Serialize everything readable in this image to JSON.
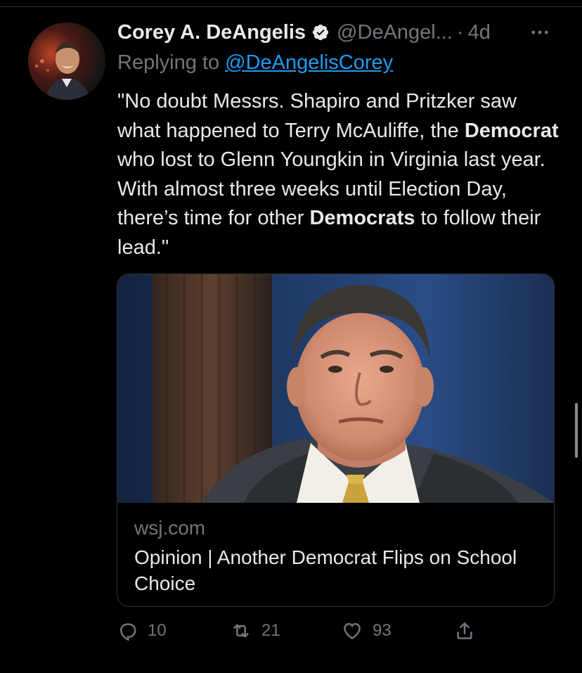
{
  "tweet": {
    "author": {
      "display_name": "Corey A. DeAngelis",
      "handle": "@DeAngel...",
      "verified": true
    },
    "separator": "·",
    "time": "4d",
    "reply": {
      "prefix": "Replying to ",
      "mention": "@DeAngelisCorey"
    },
    "text": {
      "part1": "\"No doubt Messrs. Shapiro and Pritzker saw what happened to Terry McAuliffe, the ",
      "bold1": "Democrat",
      "part2": " who lost to Glenn Youngkin in Virginia last year. With almost three weeks until Election Day, there’s time for other ",
      "bold2": "Democrats",
      "part3": " to follow their lead.\""
    },
    "card": {
      "domain": "wsj.com",
      "title": "Opinion | Another Democrat Flips on School Choice"
    },
    "actions": {
      "reply_count": "10",
      "retweet_count": "21",
      "like_count": "93"
    }
  },
  "colors": {
    "background": "#000000",
    "text": "#e7e9ea",
    "secondary": "#71767b",
    "link": "#1d9bf0",
    "border": "#2f3336"
  },
  "icons": {
    "verified": "verified-badge-icon",
    "more": "more-horizontal-icon",
    "reply": "reply-icon",
    "retweet": "retweet-icon",
    "like": "heart-icon",
    "share": "share-icon"
  }
}
